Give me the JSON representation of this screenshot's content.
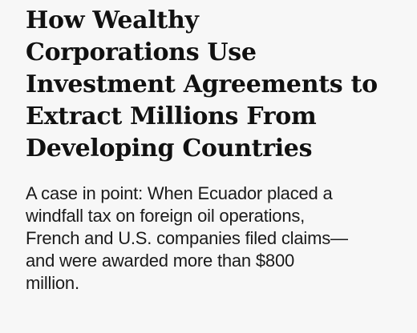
{
  "article": {
    "headline": "How Wealthy\nCorporations Use\nInvestment Agreements to\nExtract Millions From\nDeveloping Countries",
    "dek": "A case in point: When Ecuador placed a\nwindfall tax on foreign oil operations,\nFrench and U.S. companies filed claims—\nand were awarded more than $800\nmillion."
  },
  "colors": {
    "background": "#f7f7f7",
    "headline": "#111111",
    "body_text": "#1a1a1a"
  }
}
